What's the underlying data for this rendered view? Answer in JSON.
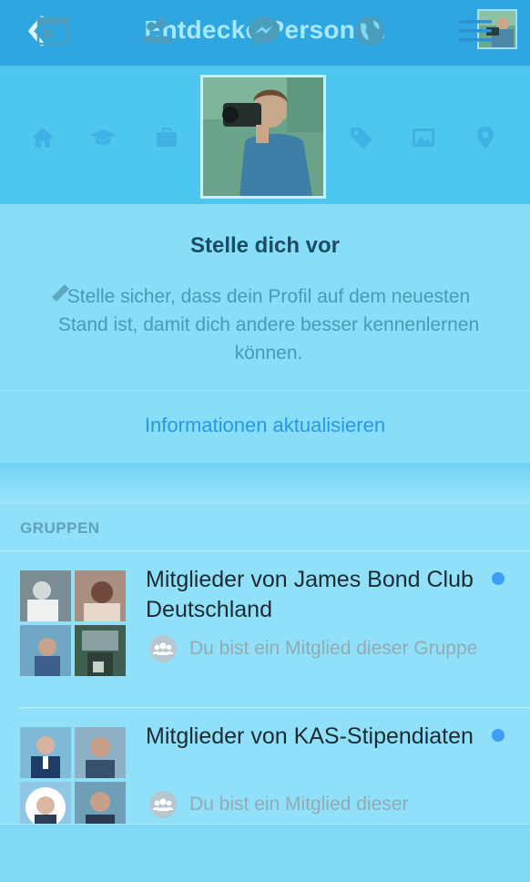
{
  "nav": {
    "title": "Entdecke Personen",
    "back_icon": "chevron-left-icon",
    "avatar": "profile-avatar"
  },
  "profile_band": {
    "icons": [
      "home-icon",
      "education-icon",
      "work-icon",
      "tag-icon",
      "photo-icon",
      "location-icon"
    ]
  },
  "intro": {
    "title": "Stelle dich vor",
    "text": "Stelle sicher, dass dein Profil auf dem neuesten Stand ist, damit dich andere besser kennenlernen können.",
    "action": "Informationen aktualisieren"
  },
  "groups": {
    "header": "GRUPPEN",
    "items": [
      {
        "name": "Mitglieder von James Bond Club Deutschland",
        "membership": "Du bist ein Mitglied dieser Gruppe",
        "unread": true
      },
      {
        "name": "Mitglieder von KAS-Stipendiaten",
        "membership": "Du bist ein Mitglied dieser",
        "unread": true
      }
    ]
  },
  "tabbar": {
    "tabs": [
      "feed-icon",
      "friends-icon",
      "messenger-icon",
      "globe-icon",
      "menu-icon"
    ]
  },
  "colors": {
    "accent": "#2a97e1",
    "dot": "#3b9ef2",
    "header": "#2fa6e0"
  }
}
